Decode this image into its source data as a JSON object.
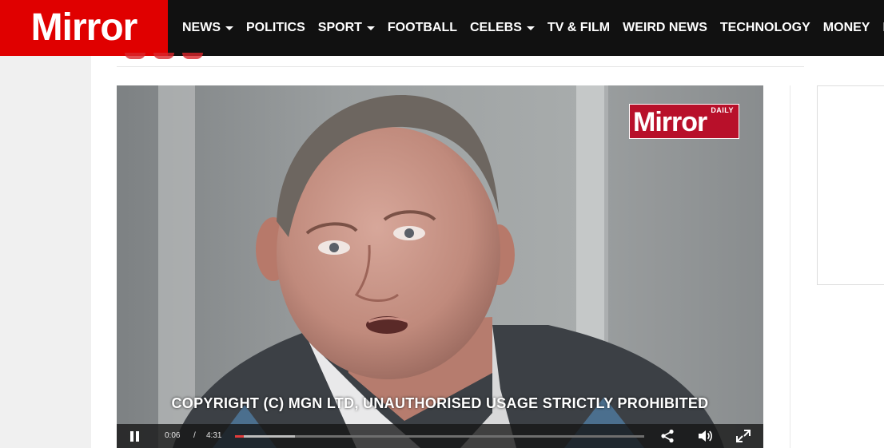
{
  "site": {
    "logo_text": "Mirror",
    "brand_color": "#e00000"
  },
  "nav": {
    "items": [
      {
        "label": "NEWS",
        "has_dropdown": true
      },
      {
        "label": "POLITICS",
        "has_dropdown": false
      },
      {
        "label": "SPORT",
        "has_dropdown": true
      },
      {
        "label": "FOOTBALL",
        "has_dropdown": false
      },
      {
        "label": "CELEBS",
        "has_dropdown": true
      },
      {
        "label": "TV & FILM",
        "has_dropdown": false
      },
      {
        "label": "WEIRD NEWS",
        "has_dropdown": false
      },
      {
        "label": "TECHNOLOGY",
        "has_dropdown": false
      },
      {
        "label": "MONEY",
        "has_dropdown": false
      },
      {
        "label": "MORE",
        "has_dropdown": false
      }
    ]
  },
  "video": {
    "watermark": {
      "small_text": "DAILY",
      "brand_text": "Mirror",
      "color": "#b8102a"
    },
    "copyright_overlay": "COPYRIGHT (C) MGN LTD, UNAUTHORISED USAGE STRICTLY PROHIBITED",
    "controls": {
      "current_time": "0:06",
      "separator": "/",
      "duration": "4:31",
      "played_fraction": 0.022,
      "buffered_fraction": 0.147,
      "played_color": "#e23c3c",
      "play_state_icon": "pause-icon",
      "share_icon": "share-icon",
      "volume_icon": "volume-icon",
      "fullscreen_icon": "fullscreen-icon"
    }
  }
}
